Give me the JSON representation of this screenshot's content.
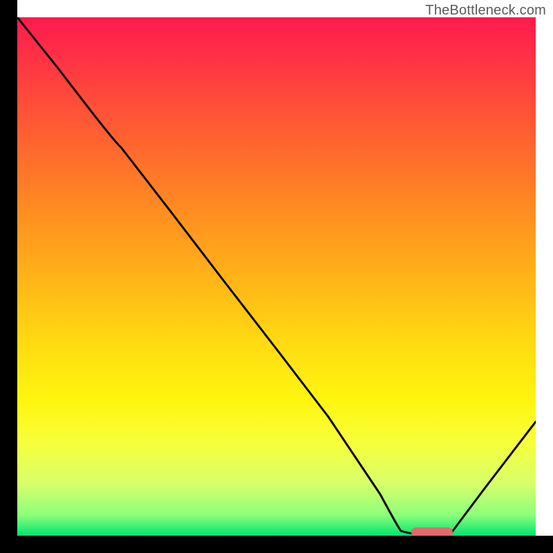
{
  "watermark": "TheBottleneck.com",
  "colors": {
    "gradient_top": "#ff1a4e",
    "gradient_bottom": "#00e571",
    "axis": "#000000",
    "curve": "#000000",
    "marker": "#e06b6b"
  },
  "chart_data": {
    "type": "line",
    "title": "",
    "xlabel": "",
    "ylabel": "",
    "x": [
      0.0,
      0.08,
      0.2,
      0.3,
      0.4,
      0.5,
      0.6,
      0.7,
      0.74,
      0.8,
      0.84,
      0.9,
      1.0
    ],
    "values": [
      1.0,
      0.9,
      0.75,
      0.62,
      0.49,
      0.36,
      0.23,
      0.08,
      0.01,
      0.0,
      0.01,
      0.09,
      0.22
    ],
    "xlim": [
      0,
      1
    ],
    "ylim": [
      0,
      1
    ],
    "optimal_region": {
      "x_start": 0.76,
      "x_end": 0.84,
      "y": 0.005
    }
  }
}
